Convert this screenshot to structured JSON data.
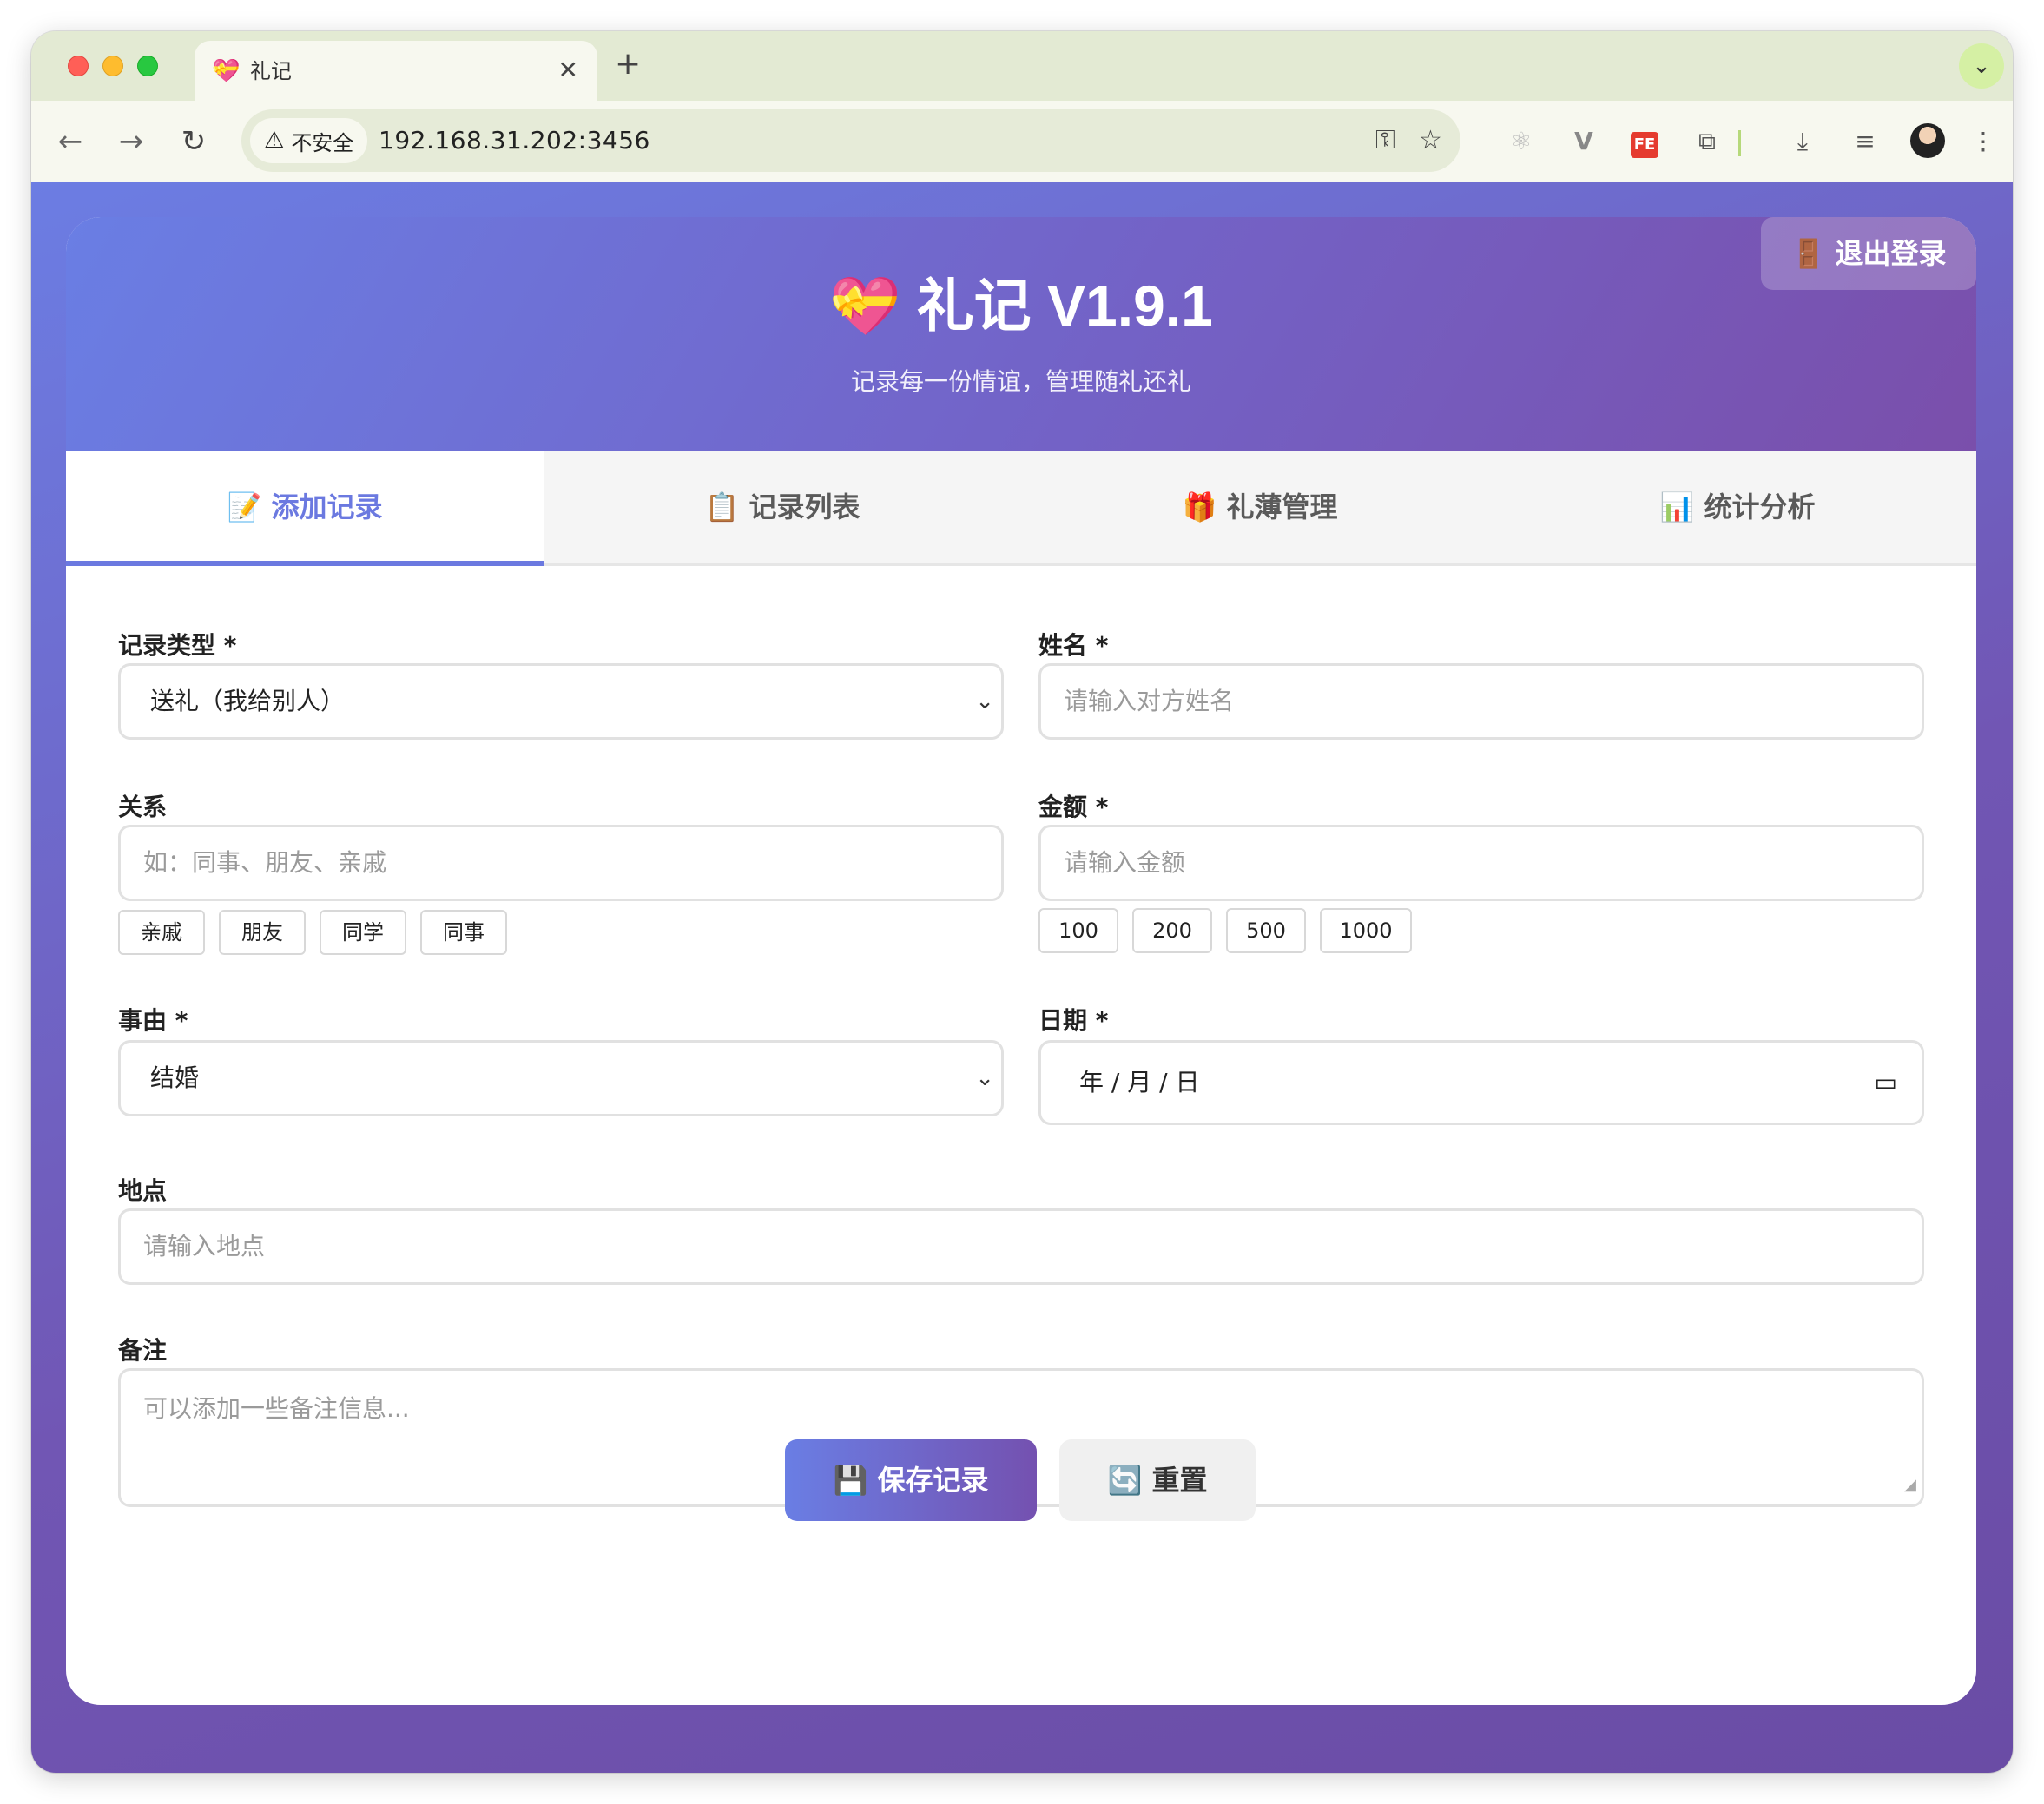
{
  "browser": {
    "tab_title": "礼记",
    "tab_favicon": "💝",
    "security_label": "不安全",
    "url": "192.168.31.202:3456"
  },
  "header": {
    "icon": "💝",
    "title": "礼记 V1.9.1",
    "subtitle": "记录每一份情谊，管理随礼还礼",
    "logout_label": "🚪 退出登录"
  },
  "tabs": [
    {
      "label": "📝 添加记录",
      "active": true
    },
    {
      "label": "📋 记录列表",
      "active": false
    },
    {
      "label": "🎁 礼薄管理",
      "active": false
    },
    {
      "label": "📊 统计分析",
      "active": false
    }
  ],
  "form": {
    "record_type": {
      "label": "记录类型 *",
      "value": "送礼（我给别人）"
    },
    "name": {
      "label": "姓名 *",
      "placeholder": "请输入对方姓名"
    },
    "relation": {
      "label": "关系",
      "placeholder": "如：同事、朋友、亲戚",
      "quick": [
        "亲戚",
        "朋友",
        "同学",
        "同事"
      ]
    },
    "amount": {
      "label": "金额 *",
      "placeholder": "请输入金额",
      "quick": [
        "100",
        "200",
        "500",
        "1000"
      ]
    },
    "reason": {
      "label": "事由 *",
      "value": "结婚"
    },
    "date": {
      "label": "日期 *",
      "value": "年  / 月 / 日"
    },
    "location": {
      "label": "地点",
      "placeholder": "请输入地点"
    },
    "notes": {
      "label": "备注",
      "placeholder": "可以添加一些备注信息..."
    },
    "save_label": "💾 保存记录",
    "reset_label": "🔄 重置"
  }
}
